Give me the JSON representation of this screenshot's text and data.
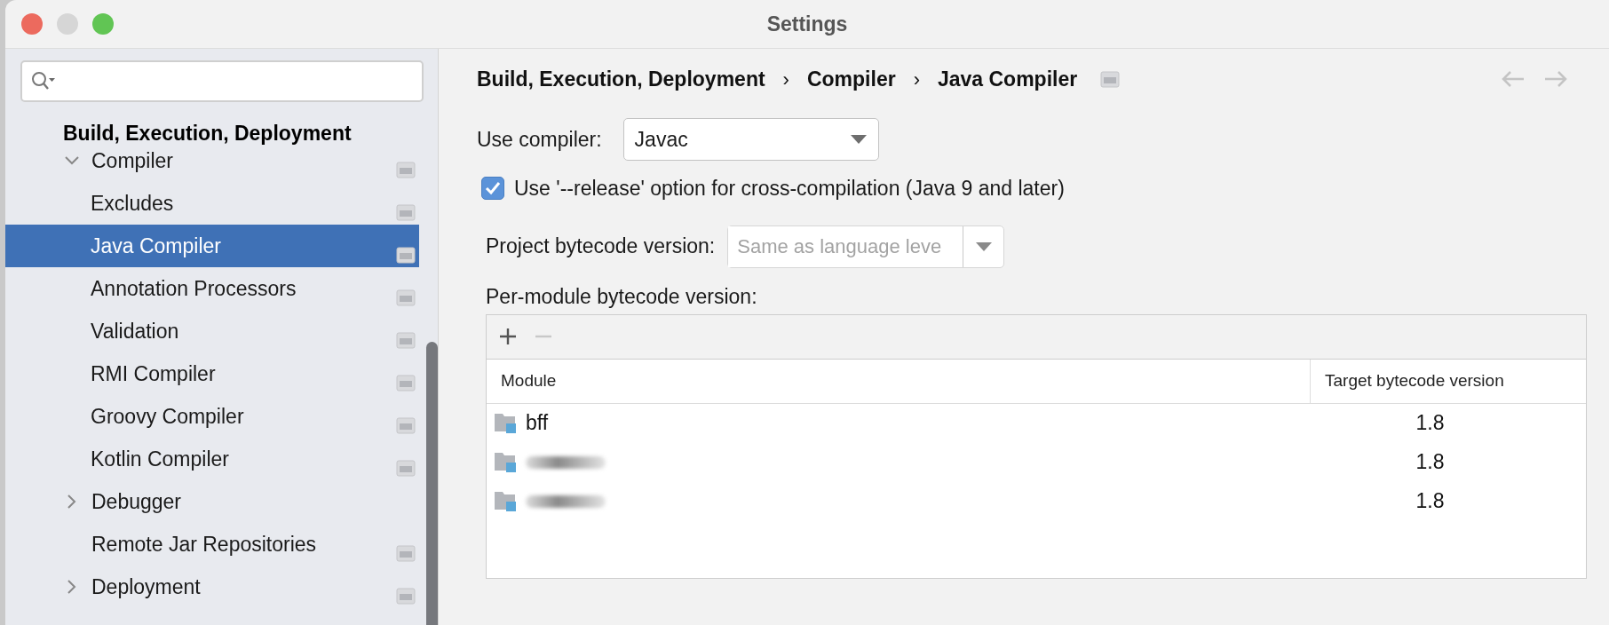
{
  "window": {
    "title": "Settings",
    "traffic_lights": [
      {
        "color": "#ec6a5e"
      },
      {
        "color": "#d6d6d6"
      },
      {
        "color": "#61c554"
      }
    ]
  },
  "sidebar": {
    "section": "Build, Execution, Deployment",
    "items": [
      {
        "label": "Compiler",
        "expanded": true,
        "selected": false,
        "project_level": true,
        "children": [
          {
            "label": "Excludes",
            "selected": false,
            "project_level": true
          },
          {
            "label": "Java Compiler",
            "selected": true,
            "project_level": true
          },
          {
            "label": "Annotation Processors",
            "selected": false,
            "project_level": true
          },
          {
            "label": "Validation",
            "selected": false,
            "project_level": true
          },
          {
            "label": "RMI Compiler",
            "selected": false,
            "project_level": true
          },
          {
            "label": "Groovy Compiler",
            "selected": false,
            "project_level": true
          },
          {
            "label": "Kotlin Compiler",
            "selected": false,
            "project_level": true
          }
        ]
      },
      {
        "label": "Debugger",
        "expanded": false,
        "selected": false,
        "project_level": false
      },
      {
        "label": "Remote Jar Repositories",
        "selected": false,
        "project_level": true
      },
      {
        "label": "Deployment",
        "expanded": false,
        "selected": false,
        "project_level": true
      }
    ]
  },
  "breadcrumb": {
    "separator": "›",
    "parts": [
      "Build, Execution, Deployment",
      "Compiler",
      "Java Compiler"
    ],
    "project_level": true
  },
  "nav": [
    {
      "kind": "back",
      "disabled": true
    },
    {
      "kind": "forward",
      "disabled": true
    }
  ],
  "use_compiler": {
    "label": "Use compiler:",
    "value": "Javac"
  },
  "release_option": {
    "label": "Use '--release' option for cross-compilation (Java 9 and later)",
    "checked": true
  },
  "project_bytecode": {
    "label": "Project bytecode version:",
    "placeholder": "Same as language leve",
    "disabled": true
  },
  "per_module": {
    "label": "Per-module bytecode version:",
    "toolbar": [
      {
        "kind": "add",
        "disabled": false
      },
      {
        "kind": "remove",
        "disabled": true
      }
    ],
    "columns": [
      "Module",
      "Target bytecode version"
    ],
    "rows": [
      {
        "module": "bff",
        "redacted": false,
        "target": "1.8"
      },
      {
        "redacted": true,
        "target": "1.8"
      },
      {
        "redacted": true,
        "target": "1.8"
      }
    ]
  }
}
